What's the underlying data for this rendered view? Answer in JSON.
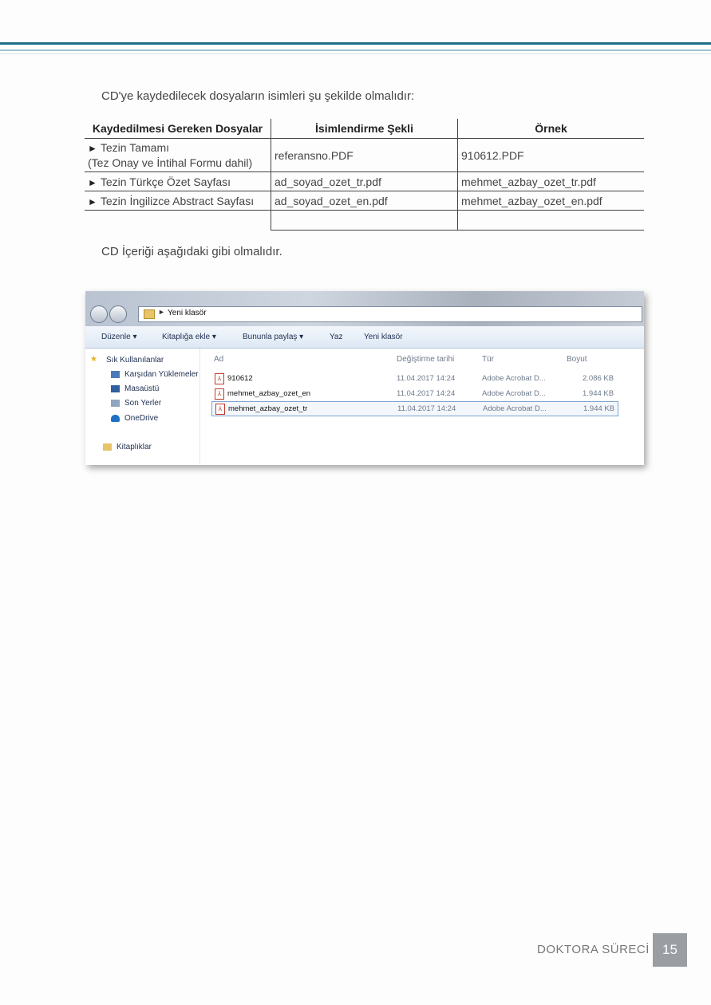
{
  "intro_text": "CD'ye kaydedilecek dosyaların isimleri şu şekilde olmalıdır:",
  "table": {
    "headers": [
      "Kaydedilmesi Gereken Dosyalar",
      "İsimlendirme Şekli",
      "Örnek"
    ],
    "rows": [
      {
        "file_line1": "Tezin Tamamı",
        "file_line2": "(Tez Onay ve İntihal Formu dahil)",
        "naming": "referansno.PDF",
        "example": "910612.PDF"
      },
      {
        "file_line1": "Tezin Türkçe Özet Sayfası",
        "naming": "ad_soyad_ozet_tr.pdf",
        "example": "mehmet_azbay_ozet_tr.pdf"
      },
      {
        "file_line1": "Tezin İngilizce Abstract Sayfası",
        "naming": "ad_soyad_ozet_en.pdf",
        "example": "mehmet_azbay_ozet_en.pdf"
      }
    ],
    "bullet": "►"
  },
  "cd_content_text": "CD İçeriği aşağıdaki gibi olmalıdır.",
  "explorer": {
    "address": "Yeni klasör",
    "toolbar": [
      "Düzenle ▾",
      "Kitaplığa ekle ▾",
      "Bununla paylaş ▾",
      "Yaz",
      "Yeni klasör"
    ],
    "sidebar": {
      "favorites": "Sık Kullanılanlar",
      "items": [
        "Karşıdan Yüklemeler",
        "Masaüstü",
        "Son Yerler",
        "OneDrive"
      ],
      "libraries": "Kitaplıklar"
    },
    "columns": [
      "Ad",
      "Değiştirme tarihi",
      "Tür",
      "Boyut"
    ],
    "files": [
      {
        "name": "910612",
        "date": "11.04.2017 14:24",
        "type": "Adobe Acrobat D...",
        "size": "2.086 KB"
      },
      {
        "name": "mehmet_azbay_ozet_en",
        "date": "11.04.2017 14:24",
        "type": "Adobe Acrobat D...",
        "size": "1.944 KB"
      },
      {
        "name": "mehmet_azbay_ozet_tr",
        "date": "11.04.2017 14:24",
        "type": "Adobe Acrobat D...",
        "size": "1.944 KB"
      }
    ]
  },
  "footer": {
    "label": "DOKTORA SÜRECİ",
    "page": "15"
  },
  "colors": {
    "accent": "#1d6e86",
    "page_box": "#9a9ea3"
  }
}
